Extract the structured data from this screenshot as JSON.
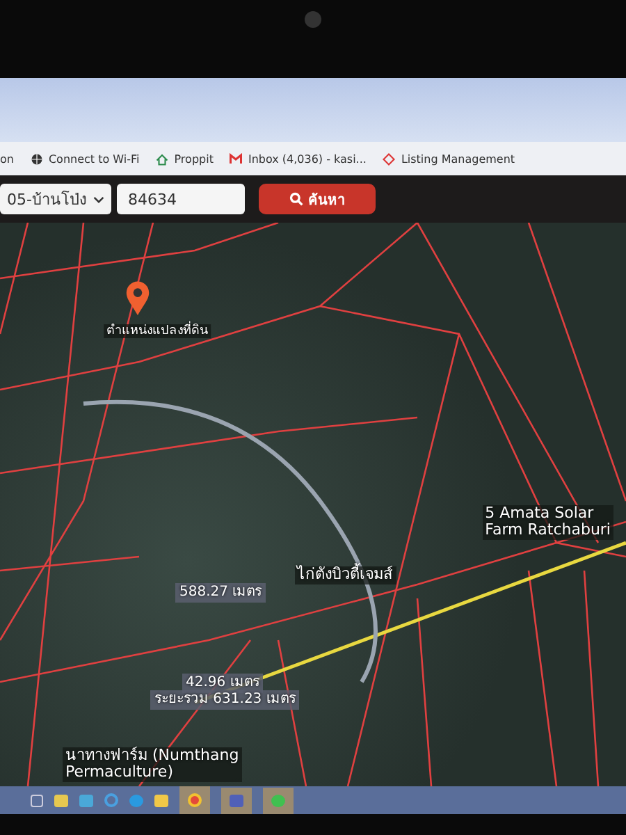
{
  "bookmarks": [
    {
      "label": "on"
    },
    {
      "label": "Connect to Wi-Fi"
    },
    {
      "label": "Proppit"
    },
    {
      "label": "Inbox (4,036) - kasi..."
    },
    {
      "label": "Listing Management"
    }
  ],
  "toolbar": {
    "district": "05-บ้านโป่ง",
    "parcel_number": "84634",
    "search_button": "ค้นหา"
  },
  "map": {
    "labels": [
      {
        "kind": "pin",
        "text": "ตำแหน่งแปลงที่ดิน"
      },
      {
        "kind": "place",
        "text": "5 Amata Solar\nFarm Ratchaburi"
      },
      {
        "kind": "place",
        "text": "ไก่ตังบิวตี้เจมส์"
      },
      {
        "kind": "measure",
        "text": "588.27 เมตร"
      },
      {
        "kind": "measure",
        "text": "42.96 เมตร"
      },
      {
        "kind": "measure",
        "text": "ระยะรวม 631.23 เมตร"
      },
      {
        "kind": "place",
        "text": "นาทางฟาร์ม (Numthang\nPermaculture)"
      }
    ]
  }
}
